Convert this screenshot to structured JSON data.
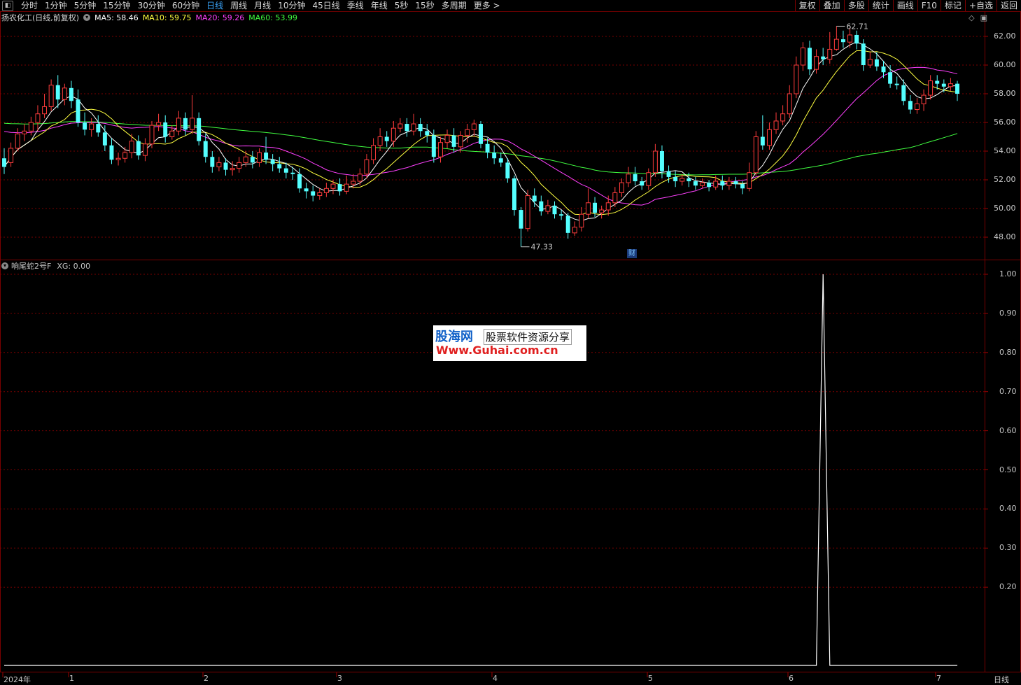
{
  "toolbar": {
    "periods": [
      "分时",
      "1分钟",
      "5分钟",
      "15分钟",
      "30分钟",
      "60分钟",
      "日线",
      "周线",
      "月线",
      "10分钟",
      "45日线",
      "季线",
      "年线",
      "5秒",
      "15秒",
      "多周期",
      "更多 >"
    ],
    "active_period": "日线",
    "right_buttons": [
      "复权",
      "叠加",
      "多股",
      "统计",
      "画线",
      "F10",
      "标记",
      "+自选",
      "返回"
    ]
  },
  "main_chart": {
    "title": "扬农化工(日线,前复权)",
    "ma": [
      {
        "label": "MA5: 58.46",
        "color": "#ffffff"
      },
      {
        "label": "MA10: 59.75",
        "color": "#ffff40"
      },
      {
        "label": "MA20: 59.26",
        "color": "#ff40ff"
      },
      {
        "label": "MA60: 53.99",
        "color": "#40ff40"
      }
    ],
    "price_ticks": [
      "62.00",
      "60.00",
      "58.00",
      "56.00",
      "54.00",
      "52.00",
      "50.00",
      "48.00"
    ],
    "high_marker": "62.71",
    "low_marker": "47.33",
    "badge": "财"
  },
  "indicator": {
    "title": "响尾蛇2号F",
    "value_label": "XG: 0.00",
    "ticks": [
      "1.00",
      "0.90",
      "0.80",
      "0.70",
      "0.60",
      "0.50",
      "0.40",
      "0.30",
      "0.20"
    ]
  },
  "x_axis": {
    "labels": [
      "2024年",
      "1",
      "2",
      "3",
      "4",
      "5",
      "6",
      "7"
    ],
    "period_label": "日线"
  },
  "watermark": {
    "brand": "股海网",
    "slogan": "股票软件资源分享",
    "url": "Www.Guhai.com.cn"
  },
  "colors": {
    "up": "#ff3c3c",
    "down": "#54ffff",
    "grid": "#7a0000",
    "ma5": "#ffffff",
    "ma10": "#ffff40",
    "ma20": "#ff40ff",
    "ma60": "#40ff40"
  },
  "chart_data": {
    "type": "candlestick",
    "title": "扬农化工(日线,前复权)",
    "ylim": [
      47,
      63
    ],
    "candles": [
      [
        53.5,
        52.9,
        54.2,
        52.4
      ],
      [
        53.2,
        54.2,
        54.6,
        52.9
      ],
      [
        54.2,
        55.2,
        55.6,
        54.0
      ],
      [
        55.2,
        55.4,
        55.9,
        54.7
      ],
      [
        55.4,
        56.0,
        56.4,
        55.1
      ],
      [
        56.0,
        56.6,
        57.2,
        55.4
      ],
      [
        56.6,
        57.1,
        58.0,
        56.3
      ],
      [
        57.1,
        58.6,
        59.0,
        56.8
      ],
      [
        58.6,
        57.6,
        59.3,
        57.0
      ],
      [
        57.6,
        58.4,
        58.7,
        57.2
      ],
      [
        58.4,
        57.5,
        58.9,
        57.0
      ],
      [
        57.6,
        56.0,
        58.3,
        55.7
      ],
      [
        56.0,
        55.5,
        56.7,
        55.1
      ],
      [
        55.5,
        55.9,
        56.3,
        55.0
      ],
      [
        55.9,
        55.3,
        56.5,
        55.0
      ],
      [
        55.3,
        54.4,
        55.8,
        54.0
      ],
      [
        54.4,
        53.4,
        54.9,
        53.1
      ],
      [
        53.4,
        53.5,
        53.9,
        53.0
      ],
      [
        53.5,
        53.9,
        54.3,
        53.2
      ],
      [
        53.9,
        54.7,
        55.2,
        53.5
      ],
      [
        54.7,
        53.7,
        55.1,
        53.4
      ],
      [
        53.7,
        54.5,
        54.9,
        53.3
      ],
      [
        54.5,
        55.8,
        56.1,
        54.2
      ],
      [
        55.8,
        56.0,
        56.6,
        55.4
      ],
      [
        56.0,
        55.0,
        56.5,
        54.6
      ],
      [
        55.0,
        55.4,
        55.8,
        54.8
      ],
      [
        55.4,
        56.3,
        56.8,
        55.1
      ],
      [
        56.3,
        55.5,
        56.7,
        55.1
      ],
      [
        55.5,
        56.3,
        57.9,
        55.2
      ],
      [
        56.3,
        54.7,
        56.7,
        54.4
      ],
      [
        54.7,
        53.6,
        55.2,
        53.2
      ],
      [
        53.6,
        52.9,
        54.0,
        52.5
      ],
      [
        52.9,
        53.2,
        53.6,
        52.6
      ],
      [
        53.2,
        52.7,
        53.5,
        52.3
      ],
      [
        52.7,
        52.8,
        53.3,
        52.3
      ],
      [
        52.8,
        53.2,
        53.6,
        52.5
      ],
      [
        53.2,
        53.6,
        54.0,
        52.9
      ],
      [
        53.6,
        53.2,
        54.0,
        52.8
      ],
      [
        53.2,
        53.9,
        54.2,
        52.9
      ],
      [
        53.9,
        53.4,
        55.0,
        53.1
      ],
      [
        53.4,
        53.1,
        53.8,
        52.6
      ],
      [
        53.1,
        52.8,
        53.6,
        52.5
      ],
      [
        52.8,
        52.5,
        53.2,
        52.1
      ],
      [
        52.5,
        52.4,
        52.9,
        52.0
      ],
      [
        52.4,
        51.4,
        52.8,
        51.1
      ],
      [
        51.4,
        51.2,
        51.8,
        50.7
      ],
      [
        51.2,
        50.9,
        51.6,
        50.5
      ],
      [
        50.9,
        51.1,
        51.4,
        50.6
      ],
      [
        51.1,
        51.4,
        51.8,
        50.8
      ],
      [
        51.4,
        51.7,
        52.0,
        51.0
      ],
      [
        51.7,
        51.2,
        52.1,
        50.9
      ],
      [
        51.2,
        51.7,
        52.3,
        51.0
      ],
      [
        51.7,
        51.9,
        52.4,
        51.4
      ],
      [
        51.9,
        52.4,
        52.8,
        51.6
      ],
      [
        52.4,
        53.4,
        53.8,
        52.1
      ],
      [
        53.4,
        54.4,
        54.9,
        53.1
      ],
      [
        54.4,
        55.0,
        55.6,
        54.0
      ],
      [
        55.0,
        54.7,
        55.4,
        54.3
      ],
      [
        54.7,
        55.6,
        56.1,
        54.3
      ],
      [
        55.6,
        55.9,
        56.3,
        55.3
      ],
      [
        55.9,
        55.4,
        56.3,
        55.0
      ],
      [
        55.4,
        55.9,
        56.6,
        55.1
      ],
      [
        55.9,
        55.4,
        56.3,
        55.0
      ],
      [
        55.4,
        55.1,
        55.9,
        54.6
      ],
      [
        55.1,
        53.6,
        55.5,
        53.2
      ],
      [
        53.6,
        54.6,
        55.0,
        53.2
      ],
      [
        54.6,
        55.1,
        55.5,
        54.2
      ],
      [
        55.1,
        54.3,
        55.6,
        53.9
      ],
      [
        54.3,
        55.1,
        55.4,
        53.9
      ],
      [
        55.1,
        55.5,
        55.9,
        54.6
      ],
      [
        55.5,
        55.9,
        56.2,
        55.0
      ],
      [
        55.9,
        54.5,
        56.1,
        54.2
      ],
      [
        54.5,
        53.9,
        54.9,
        53.5
      ],
      [
        53.9,
        53.5,
        54.4,
        53.1
      ],
      [
        53.5,
        53.2,
        53.9,
        52.9
      ],
      [
        53.2,
        52.1,
        53.5,
        51.8
      ],
      [
        52.1,
        49.9,
        52.3,
        49.5
      ],
      [
        49.9,
        48.6,
        50.1,
        47.33
      ],
      [
        48.6,
        50.9,
        51.3,
        48.4
      ],
      [
        50.9,
        50.5,
        51.4,
        50.1
      ],
      [
        50.5,
        49.8,
        50.9,
        49.5
      ],
      [
        49.8,
        50.2,
        50.6,
        49.6
      ],
      [
        50.2,
        49.6,
        50.5,
        49.3
      ],
      [
        49.6,
        49.5,
        49.9,
        49.2
      ],
      [
        49.5,
        48.3,
        49.7,
        47.9
      ],
      [
        48.3,
        48.7,
        49.1,
        48.1
      ],
      [
        48.7,
        49.6,
        50.1,
        48.4
      ],
      [
        49.6,
        50.4,
        51.4,
        49.3
      ],
      [
        50.4,
        49.7,
        50.8,
        49.4
      ],
      [
        49.7,
        49.9,
        50.2,
        49.3
      ],
      [
        49.9,
        50.4,
        50.9,
        49.5
      ],
      [
        50.4,
        51.1,
        51.5,
        50.1
      ],
      [
        51.1,
        51.8,
        52.1,
        50.8
      ],
      [
        51.8,
        52.4,
        52.9,
        51.5
      ],
      [
        52.4,
        51.9,
        52.9,
        51.6
      ],
      [
        51.9,
        51.6,
        52.2,
        51.3
      ],
      [
        51.6,
        52.5,
        52.8,
        51.3
      ],
      [
        52.5,
        54.0,
        54.5,
        52.2
      ],
      [
        54.0,
        52.6,
        54.4,
        52.1
      ],
      [
        52.6,
        52.2,
        53.0,
        51.8
      ],
      [
        52.2,
        51.9,
        52.6,
        51.5
      ],
      [
        51.9,
        52.1,
        52.4,
        51.6
      ],
      [
        52.1,
        51.9,
        52.5,
        51.5
      ],
      [
        51.9,
        51.6,
        52.2,
        51.3
      ],
      [
        51.6,
        51.8,
        52.1,
        51.4
      ],
      [
        51.8,
        51.5,
        52.0,
        51.2
      ],
      [
        51.5,
        51.9,
        52.3,
        51.3
      ],
      [
        51.9,
        51.6,
        52.3,
        51.3
      ],
      [
        51.6,
        51.9,
        52.2,
        51.3
      ],
      [
        51.9,
        51.7,
        52.2,
        51.4
      ],
      [
        51.7,
        51.4,
        51.9,
        51.0
      ],
      [
        51.4,
        52.5,
        53.2,
        51.2
      ],
      [
        52.5,
        55.0,
        55.4,
        52.3
      ],
      [
        55.0,
        54.4,
        56.5,
        54.1
      ],
      [
        54.4,
        55.5,
        56.0,
        54.1
      ],
      [
        55.5,
        56.1,
        56.7,
        55.2
      ],
      [
        56.1,
        56.6,
        57.2,
        55.8
      ],
      [
        56.6,
        58.0,
        58.6,
        56.3
      ],
      [
        58.0,
        60.0,
        60.6,
        57.7
      ],
      [
        60.0,
        61.2,
        61.6,
        59.6
      ],
      [
        61.2,
        59.7,
        61.7,
        59.3
      ],
      [
        59.7,
        60.6,
        61.1,
        59.4
      ],
      [
        60.6,
        60.4,
        61.2,
        60.0
      ],
      [
        60.4,
        61.1,
        62.3,
        60.1
      ],
      [
        61.1,
        61.8,
        62.71,
        61.0
      ],
      [
        61.8,
        61.6,
        62.4,
        61.2
      ],
      [
        61.6,
        62.1,
        62.6,
        61.2
      ],
      [
        62.1,
        61.5,
        62.4,
        61.1
      ],
      [
        61.5,
        60.0,
        61.8,
        59.6
      ],
      [
        60.0,
        60.4,
        60.9,
        59.8
      ],
      [
        60.4,
        59.9,
        60.9,
        59.6
      ],
      [
        59.9,
        59.5,
        60.3,
        59.1
      ],
      [
        59.5,
        58.7,
        60.0,
        58.4
      ],
      [
        58.7,
        58.6,
        59.2,
        58.3
      ],
      [
        58.6,
        57.5,
        59.0,
        57.2
      ],
      [
        57.5,
        56.9,
        57.9,
        56.6
      ],
      [
        56.9,
        57.3,
        57.7,
        56.6
      ],
      [
        57.3,
        57.9,
        58.3,
        56.8
      ],
      [
        57.9,
        58.9,
        59.3,
        57.6
      ],
      [
        58.9,
        58.7,
        59.3,
        58.3
      ],
      [
        58.7,
        58.5,
        59.0,
        58.1
      ],
      [
        58.5,
        58.7,
        59.1,
        58.2
      ],
      [
        58.7,
        58.0,
        58.9,
        57.5
      ]
    ],
    "indicator_series": {
      "name": "XG",
      "spike_index": 122,
      "spike_value": 1.0
    }
  }
}
